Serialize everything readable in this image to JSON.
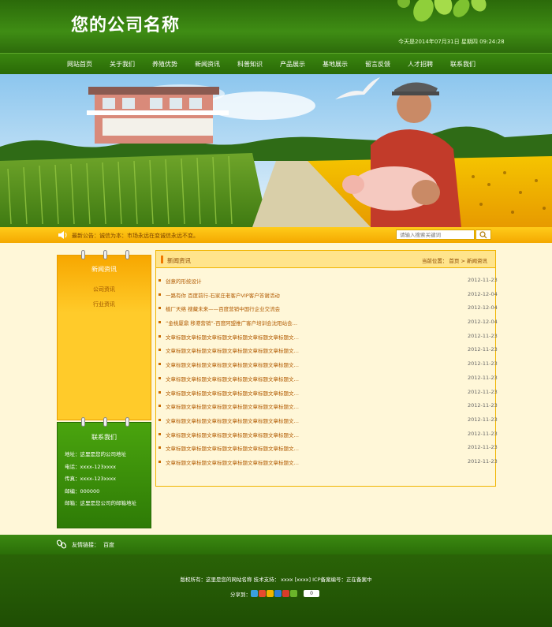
{
  "header": {
    "logo": "您的公司名称",
    "date": "今天是2014年07月31日  星期四  09:24:28"
  },
  "nav": [
    "网站首页",
    "关于我们",
    "养殖优势",
    "新闻资讯",
    "科普知识",
    "产品展示",
    "基地展示",
    "留言反馈",
    "人才招聘",
    "联系我们"
  ],
  "notice": {
    "text": "最新公告：诚信为本：市场永远在变诚信永远不变。",
    "search_placeholder": "请输入搜索关键词"
  },
  "sidebar": {
    "title": "新闻资讯",
    "items": [
      "公司资讯",
      "行业资讯"
    ]
  },
  "contact": {
    "title": "联系我们",
    "lines": [
      "地址：这里是您的公司地址",
      "电话：xxxx-123xxxx",
      "传真：xxxx-123xxxx",
      "邮编：000000",
      "邮箱：这里是您公司的邮箱地址"
    ]
  },
  "main": {
    "title": "新闻资讯",
    "crumb": "当前位置： 首页 > 新闻资讯",
    "news": [
      {
        "title": "创意的形统设计",
        "date": "2012-11-23"
      },
      {
        "title": "一路有你 百度前行-石家庄老客户VIP客户答谢活动",
        "date": "2012-12-04"
      },
      {
        "title": "植厂天络 搜藏未来——百度营销中国行企业交流会",
        "date": "2012-12-04"
      },
      {
        "title": "“金桃厦鼎 移港营销”-百度阿盟推广客户培训会沈阳站会…",
        "date": "2012-12-04"
      },
      {
        "title": "文章标题文章标题文章标题文章标题文章标题文章标题文…",
        "date": "2012-11-23"
      },
      {
        "title": "文章标题文章标题文章标题文章标题文章标题文章标题文…",
        "date": "2012-11-23"
      },
      {
        "title": "文章标题文章标题文章标题文章标题文章标题文章标题文…",
        "date": "2012-11-23"
      },
      {
        "title": "文章标题文章标题文章标题文章标题文章标题文章标题文…",
        "date": "2012-11-23"
      },
      {
        "title": "文章标题文章标题文章标题文章标题文章标题文章标题文…",
        "date": "2012-11-23"
      },
      {
        "title": "文章标题文章标题文章标题文章标题文章标题文章标题文…",
        "date": "2012-11-23"
      },
      {
        "title": "文章标题文章标题文章标题文章标题文章标题文章标题文…",
        "date": "2012-11-23"
      },
      {
        "title": "文章标题文章标题文章标题文章标题文章标题文章标题文…",
        "date": "2012-11-23"
      },
      {
        "title": "文章标题文章标题文章标题文章标题文章标题文章标题文…",
        "date": "2012-11-23"
      },
      {
        "title": "文章标题文章标题文章标题文章标题文章标题文章标题文…",
        "date": "2012-11-23"
      }
    ]
  },
  "friends": {
    "label": "友情链接：",
    "links": [
      "百度"
    ]
  },
  "footer": {
    "copyright": "版权所有：这里是您的网站名称   技术支持： xxxx  [xxxx]   ICP备案编号：正在备案中",
    "share_label": "分享到：",
    "share_count": "0"
  },
  "colors": {
    "primary_green": "#2f7a0a",
    "accent_yellow": "#ffcb2a",
    "link_brown": "#b15a00"
  }
}
